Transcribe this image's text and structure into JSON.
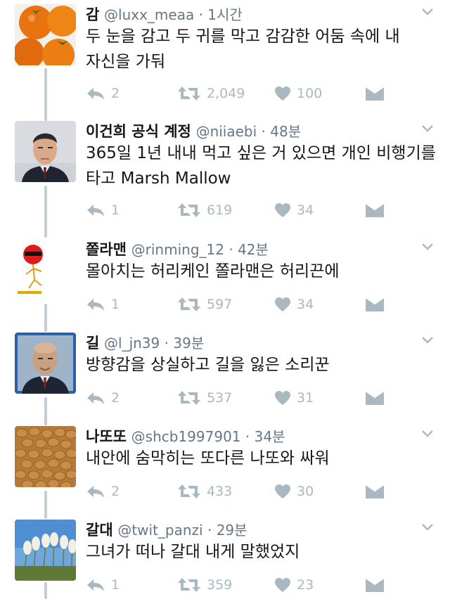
{
  "colors": {
    "name": "#14171a",
    "meta": "#657786",
    "icon": "#aab8c2",
    "thread": "#c4cdd5"
  },
  "tweets": [
    {
      "name": "감",
      "handle": "@luxx_meaa",
      "time": "1시간",
      "text": "두 눈을 감고 두 귀를 막고 감감한 어둠 속에 내 자신을 가둬",
      "replies": "2",
      "retweets": "2,049",
      "likes": "100",
      "avatar": "persimmons"
    },
    {
      "name": "이건희 공식 계정",
      "handle": "@niiaebi",
      "time": "48분",
      "text": "365일 1년 내내 먹고 싶은 거 있으면 개인 비행기를 타고 Marsh Mallow",
      "replies": "1",
      "retweets": "619",
      "likes": "34",
      "avatar": "man-in-suit"
    },
    {
      "name": "쫄라맨",
      "handle": "@rinming_12",
      "time": "42분",
      "text": "몰아치는 허리케인 쫄라맨은 허리끈에",
      "replies": "1",
      "retweets": "597",
      "likes": "34",
      "avatar": "red-stick-figure"
    },
    {
      "name": "길",
      "handle": "@l_jn39",
      "time": "39분",
      "text": "방향감을 상실하고 길을 잃은 소리꾼",
      "replies": "2",
      "retweets": "537",
      "likes": "31",
      "avatar": "bald-man"
    },
    {
      "name": "나또또",
      "handle": "@shcb1997901",
      "time": "34분",
      "text": "내안에 숨막히는 또다른 나또와 싸워",
      "replies": "2",
      "retweets": "433",
      "likes": "30",
      "avatar": "natto-beans"
    },
    {
      "name": "갈대",
      "handle": "@twit_panzi",
      "time": "29분",
      "text": "그녀가 떠나 갈대 내게 말했었지",
      "replies": "1",
      "retweets": "359",
      "likes": "23",
      "avatar": "reeds-sky"
    }
  ]
}
